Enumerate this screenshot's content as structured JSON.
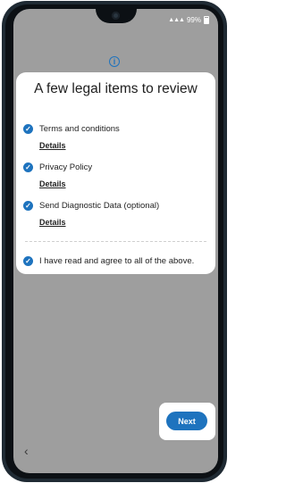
{
  "status_bar": {
    "signal": "▲▲▲",
    "battery": "99%"
  },
  "icons": {
    "info": "info-icon",
    "check": "check-circle-icon",
    "back": "chevron-left-icon"
  },
  "dialog": {
    "title": "A few legal items to review",
    "items": [
      {
        "label": "Terms and conditions",
        "link": "Details"
      },
      {
        "label": "Privacy Policy",
        "link": "Details"
      },
      {
        "label": "Send Diagnostic Data (optional)",
        "link": "Details"
      }
    ],
    "agree_all": "I have read and agree to all of the above."
  },
  "buttons": {
    "next": "Next",
    "back": "‹"
  },
  "colors": {
    "accent": "#1e73be",
    "overlay": "#9e9e9e",
    "card": "#ffffff"
  }
}
